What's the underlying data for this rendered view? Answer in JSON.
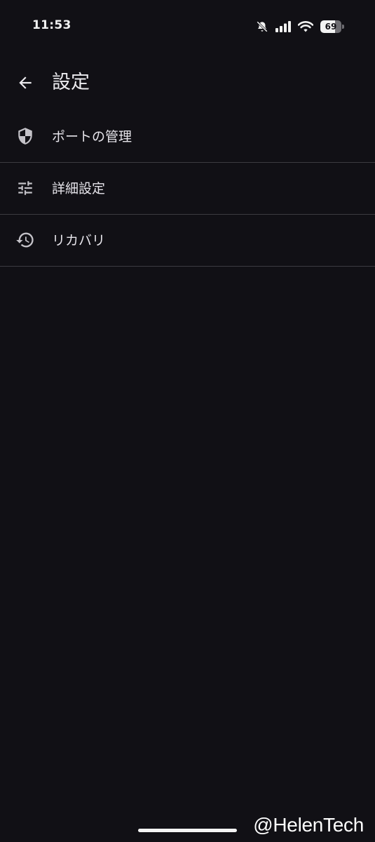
{
  "status_bar": {
    "time": "11:53",
    "battery_level": "69",
    "icons": [
      "mute-icon",
      "cellular-signal-icon",
      "wifi-icon",
      "battery-icon"
    ]
  },
  "header": {
    "back_icon": "arrow-back-icon",
    "title": "設定"
  },
  "settings": {
    "items": [
      {
        "icon": "shield-icon",
        "label": "ポートの管理"
      },
      {
        "icon": "tune-sliders-icon",
        "label": "詳細設定"
      },
      {
        "icon": "history-restore-icon",
        "label": "リカバリ"
      }
    ]
  },
  "watermark": "@HelenTech",
  "colors": {
    "background": "#111015",
    "text": "#e8e6ec",
    "divider": "#3c3b41",
    "icon": "#c4c2c8"
  }
}
